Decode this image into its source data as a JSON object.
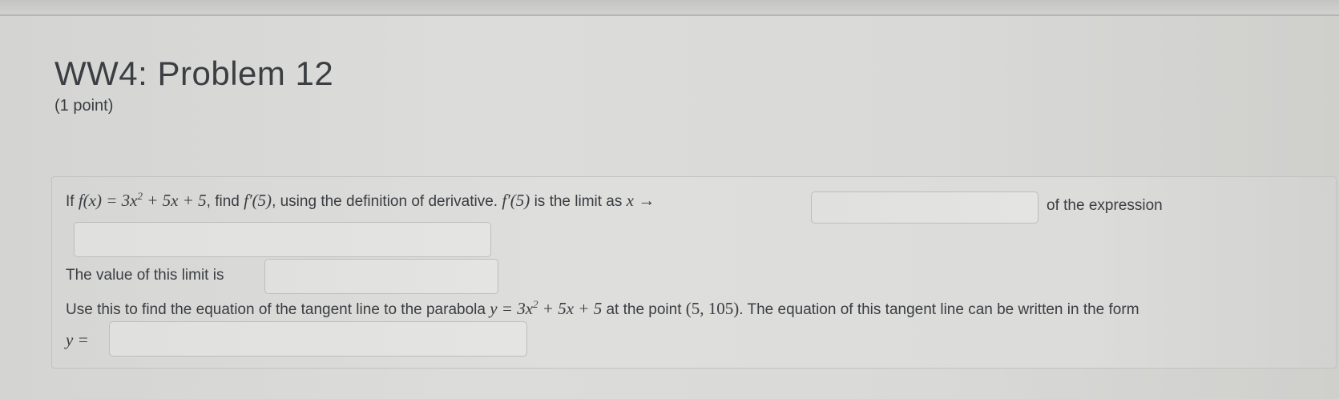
{
  "header": {
    "title": "WW4: Problem 12",
    "points": "(1 point)"
  },
  "problem": {
    "line1": {
      "prefix": "If",
      "math_fx": "f(x) = 3x",
      "math_fx_sup": "2",
      "math_fx_rest": " + 5x + 5",
      "text_find": ", find",
      "math_fp5": "f′(5)",
      "text_using": ", using the definition of derivative.",
      "math_fp5b": "f′(5)",
      "text_limit": "is the limit as",
      "math_xarrow": "x →",
      "text_expression": "of the expression"
    },
    "line3": {
      "text": "The value of this limit is"
    },
    "line4": {
      "text_a": "Use this to find the equation of the tangent line to the parabola",
      "math_y": "y = 3x",
      "math_y_sup": "2",
      "math_y_rest": " + 5x + 5",
      "text_point": "at the point",
      "math_point": "(5, 105)",
      "text_b": ". The equation of this tangent line can be written in the form"
    },
    "line5": {
      "math_y_eq": "y ="
    }
  },
  "answers": {
    "limit_point": "",
    "expression": "",
    "limit_value": "",
    "tangent_line": ""
  }
}
